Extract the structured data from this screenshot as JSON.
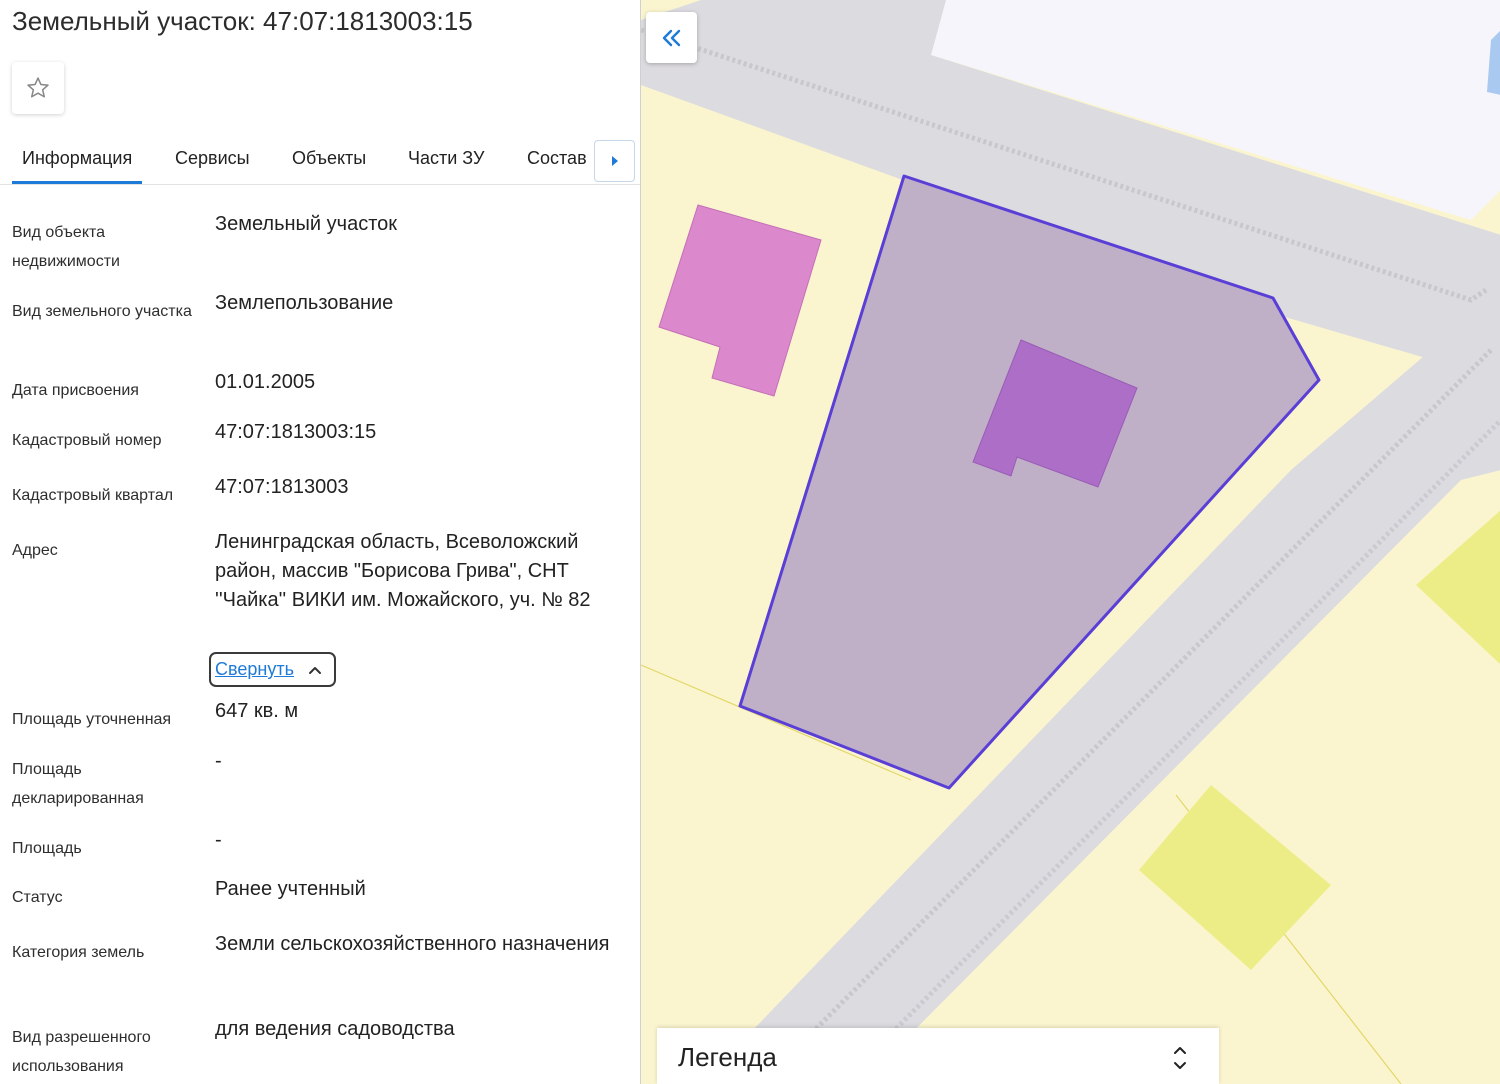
{
  "header": {
    "title": "Земельный участок: 47:07:1813003:15"
  },
  "icons": {
    "favorite": "star-outline-icon",
    "tabs_next": "caret-right-icon",
    "collapse_panel": "double-chevron-left-icon",
    "collapse_address": "chevron-up-icon",
    "legend_toggle": "chevron-up-down-icon"
  },
  "tabs": [
    {
      "label": "Информация",
      "active": true
    },
    {
      "label": "Сервисы",
      "active": false
    },
    {
      "label": "Объекты",
      "active": false
    },
    {
      "label": "Части ЗУ",
      "active": false
    },
    {
      "label": "Состав",
      "active": false
    }
  ],
  "fields": [
    {
      "label": "Вид объекта недвижимости",
      "value": "Земельный участок"
    },
    {
      "label": "Вид земельного участка",
      "value": "Землепользование"
    },
    {
      "label": "Дата присвоения",
      "value": "01.01.2005"
    },
    {
      "label": "Кадастровый номер",
      "value": "47:07:1813003:15"
    },
    {
      "label": "Кадастровый квартал",
      "value": "47:07:1813003"
    },
    {
      "label": "Адрес",
      "value": "Ленинградская область, Всеволожский район, массив \"Борисова Грива\", СНТ ''Чайка'' ВИКИ им. Можайского, уч. № 82"
    },
    {
      "label": "Площадь уточненная",
      "value": "647 кв. м"
    },
    {
      "label": "Площадь декларированная",
      "value": "-"
    },
    {
      "label": "Площадь",
      "value": "-"
    },
    {
      "label": "Статус",
      "value": "Ранее учтенный"
    },
    {
      "label": "Категория земель",
      "value": "Земли сельскохозяйственного назначения"
    },
    {
      "label": "Вид разрешенного использования",
      "value": "для ведения садоводства"
    }
  ],
  "address_toggle": {
    "label": "Свернуть"
  },
  "legend": {
    "title": "Легенда"
  },
  "colors": {
    "accent": "#1e7ad7",
    "parcel_fill": "#bfb0c8",
    "parcel_stroke": "#5a3fd6",
    "building_own": "#ac6ec6",
    "building_other": "#dc88cc",
    "land_yellow": "#fbf5cf",
    "road_gray": "#dcdbe0"
  }
}
